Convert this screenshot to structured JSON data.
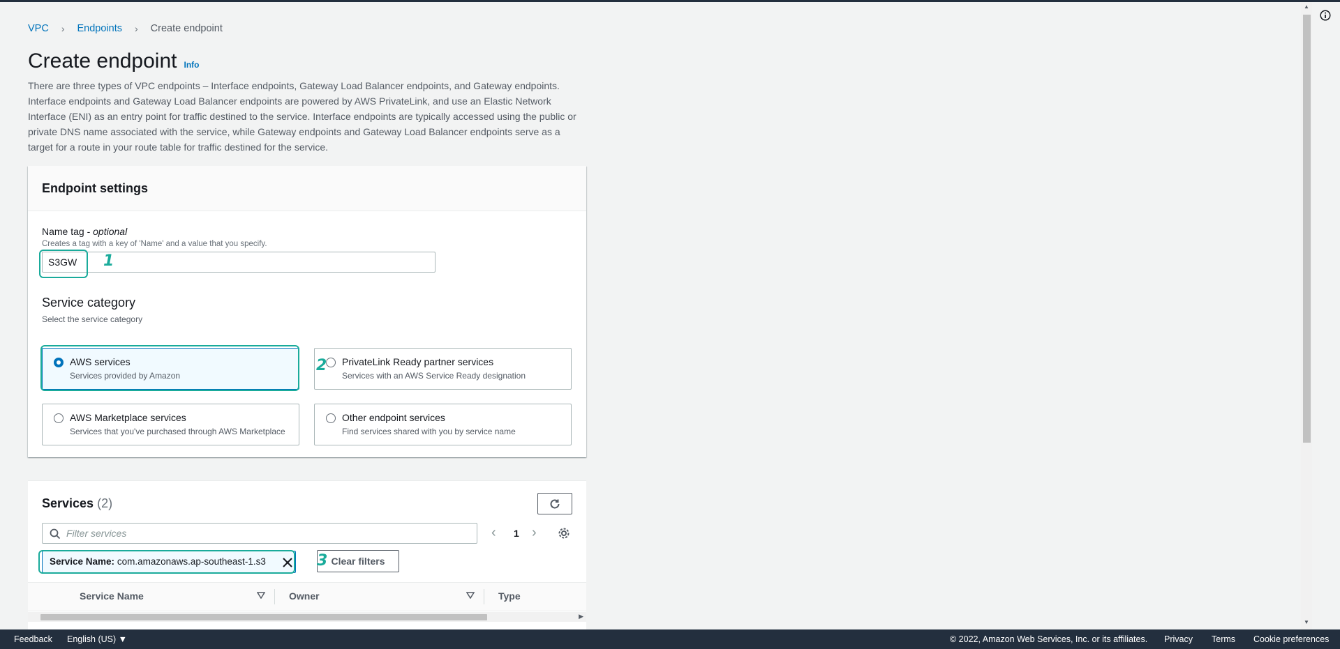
{
  "breadcrumb": {
    "vpc": "VPC",
    "endpoints": "Endpoints",
    "current": "Create endpoint"
  },
  "header": {
    "title": "Create endpoint",
    "info": "Info",
    "description": "There are three types of VPC endpoints – Interface endpoints, Gateway Load Balancer endpoints, and Gateway endpoints. Interface endpoints and Gateway Load Balancer endpoints are powered by AWS PrivateLink, and use an Elastic Network Interface (ENI) as an entry point for traffic destined to the service. Interface endpoints are typically accessed using the public or private DNS name associated with the service, while Gateway endpoints and Gateway Load Balancer endpoints serve as a target for a route in your route table for traffic destined for the service."
  },
  "settings": {
    "heading": "Endpoint settings",
    "name_label": "Name tag - ",
    "name_optional": "optional",
    "name_hint": "Creates a tag with a key of 'Name' and a value that you specify.",
    "name_value": "S3GW",
    "category_label": "Service category",
    "category_hint": "Select the service category",
    "options": [
      {
        "title": "AWS services",
        "sub": "Services provided by Amazon",
        "selected": true
      },
      {
        "title": "PrivateLink Ready partner services",
        "sub": "Services with an AWS Service Ready designation",
        "selected": false
      },
      {
        "title": "AWS Marketplace services",
        "sub": "Services that you've purchased through AWS Marketplace",
        "selected": false
      },
      {
        "title": "Other endpoint services",
        "sub": "Find services shared with you by service name",
        "selected": false
      }
    ]
  },
  "services": {
    "heading": "Services",
    "count": "(2)",
    "filter_placeholder": "Filter services",
    "page": "1",
    "token_key": "Service Name:",
    "token_value": "com.amazonaws.ap-southeast-1.s3",
    "clear_label": "Clear filters",
    "columns": [
      "Service Name",
      "Owner",
      "Type"
    ]
  },
  "callouts": [
    "1",
    "2",
    "3"
  ],
  "footer": {
    "feedback": "Feedback",
    "language": "English (US) ▼",
    "copyright": "© 2022, Amazon Web Services, Inc. or its affiliates.",
    "privacy": "Privacy",
    "terms": "Terms",
    "cookies": "Cookie preferences"
  },
  "colors": {
    "accent": "#0073bb",
    "callout": "#1aab9b",
    "footer": "#232f3e"
  }
}
